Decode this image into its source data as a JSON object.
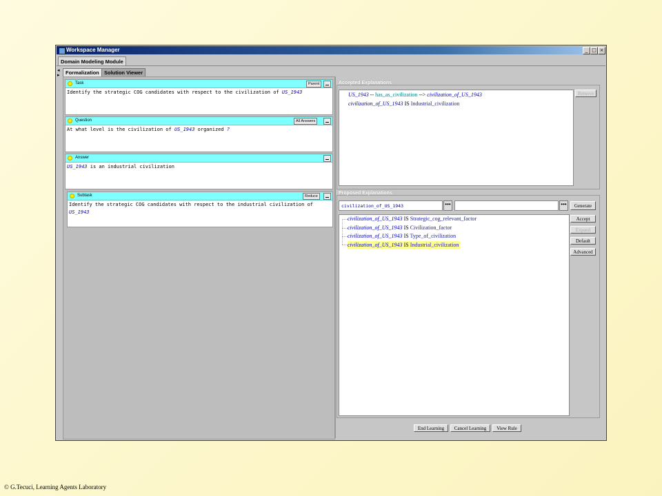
{
  "window": {
    "title": "Workspace Manager",
    "min": "_",
    "max": "□",
    "close": "×"
  },
  "module_tab": "Domain Modeling Module",
  "tabs": [
    {
      "label": "Formalization"
    },
    {
      "label": "Solution Viewer"
    }
  ],
  "task": {
    "label": "Task",
    "button": "Parent",
    "text_pre": "Identify the strategic COG candidates with respect to the civilization of ",
    "text_em": "US_1943"
  },
  "question": {
    "label": "Question",
    "button": "All Answers",
    "text_pre": "At what level is the civilization of ",
    "text_em": "US_1943",
    "text_post": " organized ",
    "text_q": "?"
  },
  "answer": {
    "label": "Answer",
    "text_em": "US_1943",
    "text_post": " is an industrial civilization"
  },
  "subtask": {
    "label": "Subtask",
    "button": "Reduce",
    "line1": "Identify the strategic COG candidates with respect to the industrial civilization of",
    "line2_em": "US_1943"
  },
  "accepted": {
    "label": "Accepted Explanations",
    "remove_button": "Remove",
    "rows": [
      {
        "a": "US_1943",
        "rel_pre": " -- ",
        "rel": "has_as_civilization",
        "rel_post": " --> ",
        "b": "civilization_of_US_1943"
      },
      {
        "a": "civilization_of_US_1943",
        "is": "IS",
        "b": "Industrial_civilization"
      }
    ]
  },
  "proposed": {
    "label": "Proposed Explanations",
    "field1": "civilization_of_US_1943",
    "field2": "",
    "dots": "•••",
    "generate": "Generate",
    "buttons": {
      "accept": "Accept",
      "expand": "Expand",
      "default": "Default",
      "advanced": "Advanced"
    },
    "rows": [
      {
        "a": "civilization_of_US_1943",
        "is": "IS",
        "b": "Strategic_cog_relevant_factor"
      },
      {
        "a": "civilization_of_US_1943",
        "is": "IS",
        "b": "Civilization_factor"
      },
      {
        "a": "civilization_of_US_1943",
        "is": "IS",
        "b": "Type_of_civilization"
      },
      {
        "a": "civilization_of_US_1943",
        "is": "IS",
        "b": "Industrial_civilization"
      }
    ]
  },
  "bottom_buttons": {
    "end": "End Learning",
    "cancel": "Cancel Learning",
    "view": "View Rule"
  },
  "footer": "© G.Tecuci, Learning Agents Laboratory",
  "colors": {
    "title_bar": "#0a246a",
    "panel_header": "#80ffff",
    "highlight": "#ffff90",
    "concept_text": "#0000c0"
  }
}
